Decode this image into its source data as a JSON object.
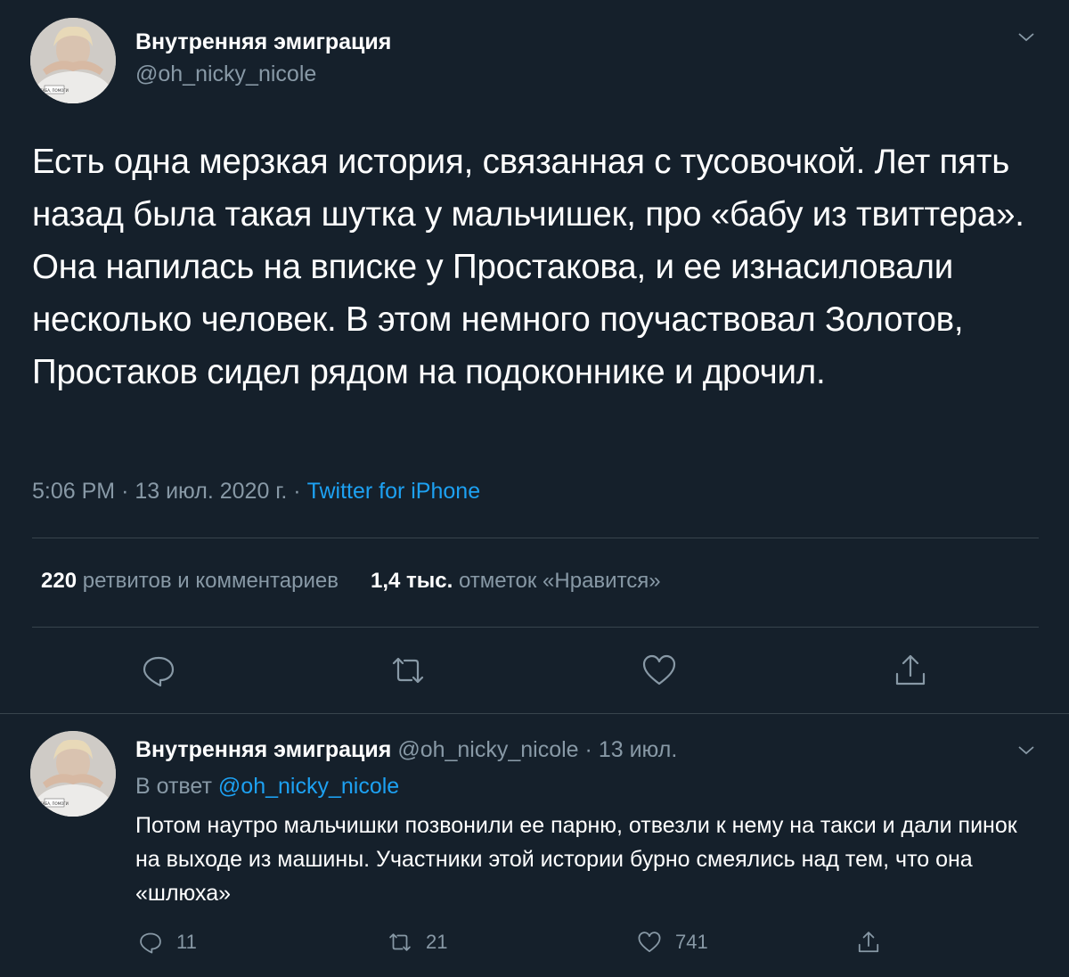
{
  "main_tweet": {
    "author_name": "Внутренняя эмиграция",
    "author_handle": "@oh_nicky_nicole",
    "text": "Есть одна мерзкая история, связанная с тусовочкой. Лет пять назад была такая шутка у мальчишек, про «бабу из твиттера». Она напилась на вписке у Простакова, и ее изнасиловали несколько человек. В этом немного поучаствовал Золотов, Простаков сидел рядом на подоконнике и дрочил.",
    "time": "5:06 PM",
    "date": "13 июл. 2020 г.",
    "separator": "·",
    "source": "Twitter for iPhone",
    "retweets_count": "220",
    "retweets_label": "ретвитов и комментариев",
    "likes_count": "1,4 тыс.",
    "likes_label": "отметок «Нравится»",
    "avatar_shirt_text": "ГАБА, ПОМОГИ"
  },
  "reply_tweet": {
    "author_name": "Внутренняя эмиграция",
    "author_handle": "@oh_nicky_nicole",
    "separator": "·",
    "date": "13 июл.",
    "reply_to_label": "В ответ",
    "reply_to_mention": "@oh_nicky_nicole",
    "text": "Потом наутро мальчишки позвонили ее парню, отвезли к нему на такси и дали пинок на выходе из машины. Участники этой истории бурно смеялись над тем, что она «шлюха»",
    "reply_count": "11",
    "retweet_count": "21",
    "like_count": "741",
    "avatar_shirt_text": "ГАБА, ПОМОГИ"
  },
  "icons": {
    "reply": "reply-icon",
    "retweet": "retweet-icon",
    "like": "heart-icon",
    "share": "share-icon",
    "caret": "chevron-down-icon"
  },
  "colors": {
    "background": "#15202b",
    "text": "#ffffff",
    "secondary": "#8899a6",
    "accent": "#1da1f2",
    "border": "#38444d"
  }
}
